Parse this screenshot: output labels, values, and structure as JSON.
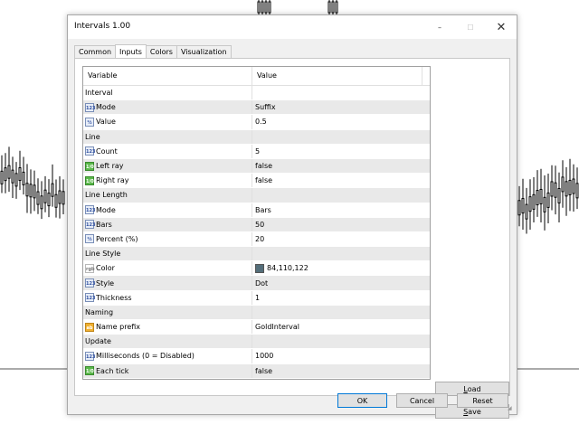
{
  "window": {
    "title": "Intervals 1.00",
    "controls": {
      "minimize": "–",
      "maximize": "☐",
      "close": "✕"
    }
  },
  "tabs": [
    {
      "label": "Common",
      "active": false
    },
    {
      "label": "Inputs",
      "active": true
    },
    {
      "label": "Colors",
      "active": false
    },
    {
      "label": "Visualization",
      "active": false
    }
  ],
  "grid": {
    "headers": {
      "variable": "Variable",
      "value": "Value"
    },
    "rows": [
      {
        "type": "group",
        "variable": "Interval",
        "value": ""
      },
      {
        "type": "param",
        "icon": "int-icon",
        "variable": "Mode",
        "value": "Suffix"
      },
      {
        "type": "param",
        "icon": "double-icon",
        "variable": "Value",
        "value": "0.5"
      },
      {
        "type": "group",
        "variable": "Line",
        "value": ""
      },
      {
        "type": "param",
        "icon": "int-icon",
        "variable": "Count",
        "value": "5"
      },
      {
        "type": "param",
        "icon": "bool-icon",
        "variable": "Left ray",
        "value": "false"
      },
      {
        "type": "param",
        "icon": "bool-icon",
        "variable": "Right ray",
        "value": "false"
      },
      {
        "type": "group",
        "variable": "Line Length",
        "value": ""
      },
      {
        "type": "param",
        "icon": "int-icon",
        "variable": "Mode",
        "value": "Bars"
      },
      {
        "type": "param",
        "icon": "int-icon",
        "variable": "Bars",
        "value": "50"
      },
      {
        "type": "param",
        "icon": "double-icon",
        "variable": "Percent (%)",
        "value": "20"
      },
      {
        "type": "group",
        "variable": "Line Style",
        "value": ""
      },
      {
        "type": "param",
        "icon": "color-icon",
        "variable": "Color",
        "value": "84,110,122",
        "swatch": "#546e7a"
      },
      {
        "type": "param",
        "icon": "int-icon",
        "variable": "Style",
        "value": "Dot"
      },
      {
        "type": "param",
        "icon": "int-icon",
        "variable": "Thickness",
        "value": "1"
      },
      {
        "type": "group",
        "variable": "Naming",
        "value": ""
      },
      {
        "type": "param",
        "icon": "string-icon",
        "variable": "Name prefix",
        "value": "GoldInterval"
      },
      {
        "type": "group",
        "variable": "Update",
        "value": ""
      },
      {
        "type": "param",
        "icon": "int-icon",
        "variable": "Milliseconds (0 = Disabled)",
        "value": "1000"
      },
      {
        "type": "param",
        "icon": "bool-icon",
        "variable": "Each tick",
        "value": "false"
      }
    ]
  },
  "icons": {
    "int-icon": "123",
    "double-icon": "½",
    "bool-icon": "1/0",
    "color-icon": "rgb",
    "string-icon": "ab"
  },
  "buttons": {
    "load": {
      "first": "L",
      "rest": "oad"
    },
    "save": {
      "first": "S",
      "rest": "ave"
    },
    "ok": "OK",
    "cancel": "Cancel",
    "reset": "Reset"
  }
}
